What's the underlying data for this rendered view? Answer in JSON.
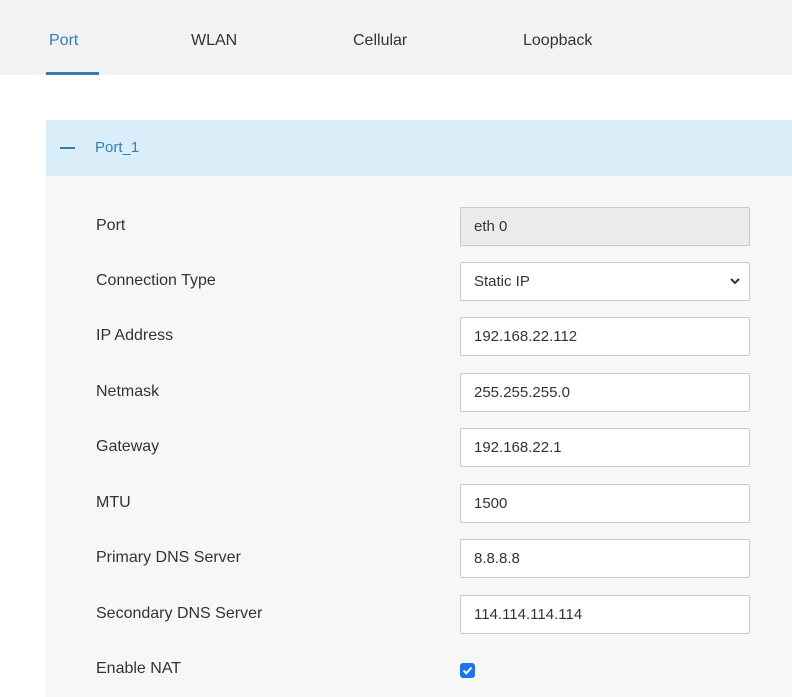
{
  "tabs": [
    {
      "label": "Port",
      "active": true
    },
    {
      "label": "WLAN",
      "active": false
    },
    {
      "label": "Cellular",
      "active": false
    },
    {
      "label": "Loopback",
      "active": false
    }
  ],
  "section": {
    "title": "Port_1",
    "expanded": true,
    "icon": "minus-icon"
  },
  "form": {
    "port": {
      "label": "Port",
      "value": "eth 0"
    },
    "connection_type": {
      "label": "Connection Type",
      "value": "Static IP"
    },
    "ip_address": {
      "label": "IP Address",
      "value": "192.168.22.112"
    },
    "netmask": {
      "label": "Netmask",
      "value": "255.255.255.0"
    },
    "gateway": {
      "label": "Gateway",
      "value": "192.168.22.1"
    },
    "mtu": {
      "label": "MTU",
      "value": "1500"
    },
    "primary_dns": {
      "label": "Primary DNS Server",
      "value": "8.8.8.8"
    },
    "secondary_dns": {
      "label": "Secondary DNS Server",
      "value": "114.114.114.114"
    },
    "enable_nat": {
      "label": "Enable NAT",
      "checked": true
    }
  },
  "colors": {
    "accent": "#2f7fb6",
    "section_header_bg": "#d9eef8",
    "tab_bar_bg": "#f2f2f2",
    "checkbox": "#1e73e8"
  }
}
